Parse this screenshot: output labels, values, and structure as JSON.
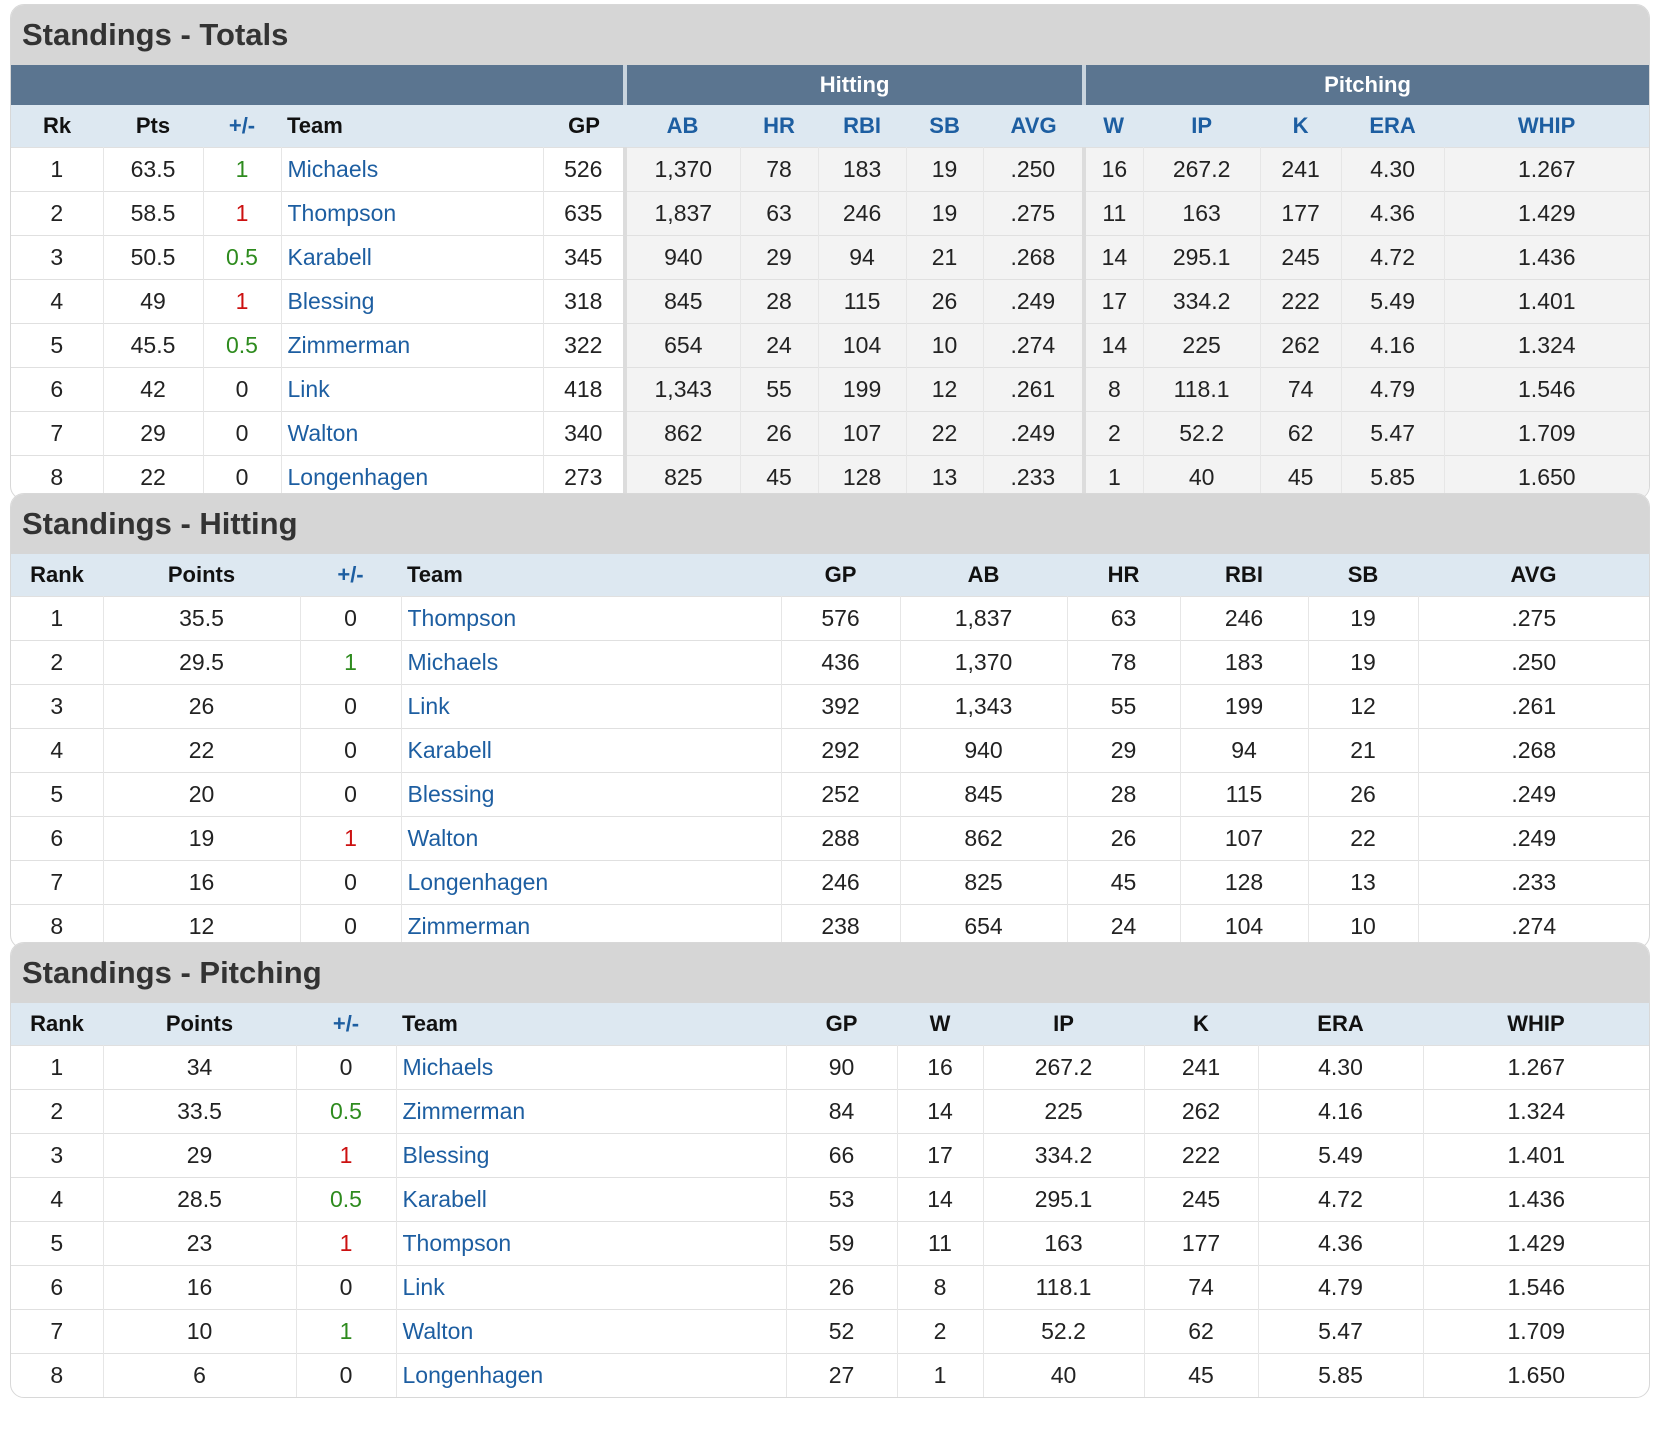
{
  "colors": {
    "positive": "#2e8b1e",
    "negative": "#cc1111",
    "link": "#1d5ea1",
    "group_header": "#5b7590"
  },
  "totals": {
    "title": "Standings - Totals",
    "groups": {
      "hitting": "Hitting",
      "pitching": "Pitching"
    },
    "columns": [
      "Rk",
      "Pts",
      "+/-",
      "Team",
      "GP",
      "AB",
      "HR",
      "RBI",
      "SB",
      "AVG",
      "W",
      "IP",
      "K",
      "ERA",
      "WHIP"
    ],
    "rows": [
      [
        "1",
        "63.5",
        "1",
        "Michaels",
        "526",
        "1,370",
        "78",
        "183",
        "19",
        ".250",
        "16",
        "267.2",
        "241",
        "4.30",
        "1.267"
      ],
      [
        "2",
        "58.5",
        "1",
        "Thompson",
        "635",
        "1,837",
        "63",
        "246",
        "19",
        ".275",
        "11",
        "163",
        "177",
        "4.36",
        "1.429"
      ],
      [
        "3",
        "50.5",
        "0.5",
        "Karabell",
        "345",
        "940",
        "29",
        "94",
        "21",
        ".268",
        "14",
        "295.1",
        "245",
        "4.72",
        "1.436"
      ],
      [
        "4",
        "49",
        "1",
        "Blessing",
        "318",
        "845",
        "28",
        "115",
        "26",
        ".249",
        "17",
        "334.2",
        "222",
        "5.49",
        "1.401"
      ],
      [
        "5",
        "45.5",
        "0.5",
        "Zimmerman",
        "322",
        "654",
        "24",
        "104",
        "10",
        ".274",
        "14",
        "225",
        "262",
        "4.16",
        "1.324"
      ],
      [
        "6",
        "42",
        "0",
        "Link",
        "418",
        "1,343",
        "55",
        "199",
        "12",
        ".261",
        "8",
        "118.1",
        "74",
        "4.79",
        "1.546"
      ],
      [
        "7",
        "29",
        "0",
        "Walton",
        "340",
        "862",
        "26",
        "107",
        "22",
        ".249",
        "2",
        "52.2",
        "62",
        "5.47",
        "1.709"
      ],
      [
        "8",
        "22",
        "0",
        "Longenhagen",
        "273",
        "825",
        "45",
        "128",
        "13",
        ".233",
        "1",
        "40",
        "45",
        "5.85",
        "1.650"
      ]
    ],
    "change_dir": [
      "up",
      "down",
      "up",
      "down",
      "up",
      "none",
      "none",
      "none"
    ]
  },
  "hitting": {
    "title": "Standings - Hitting",
    "columns": [
      "Rank",
      "Points",
      "+/-",
      "Team",
      "GP",
      "AB",
      "HR",
      "RBI",
      "SB",
      "AVG"
    ],
    "rows": [
      [
        "1",
        "35.5",
        "0",
        "Thompson",
        "576",
        "1,837",
        "63",
        "246",
        "19",
        ".275"
      ],
      [
        "2",
        "29.5",
        "1",
        "Michaels",
        "436",
        "1,370",
        "78",
        "183",
        "19",
        ".250"
      ],
      [
        "3",
        "26",
        "0",
        "Link",
        "392",
        "1,343",
        "55",
        "199",
        "12",
        ".261"
      ],
      [
        "4",
        "22",
        "0",
        "Karabell",
        "292",
        "940",
        "29",
        "94",
        "21",
        ".268"
      ],
      [
        "5",
        "20",
        "0",
        "Blessing",
        "252",
        "845",
        "28",
        "115",
        "26",
        ".249"
      ],
      [
        "6",
        "19",
        "1",
        "Walton",
        "288",
        "862",
        "26",
        "107",
        "22",
        ".249"
      ],
      [
        "7",
        "16",
        "0",
        "Longenhagen",
        "246",
        "825",
        "45",
        "128",
        "13",
        ".233"
      ],
      [
        "8",
        "12",
        "0",
        "Zimmerman",
        "238",
        "654",
        "24",
        "104",
        "10",
        ".274"
      ]
    ],
    "change_dir": [
      "none",
      "up",
      "none",
      "none",
      "none",
      "down",
      "none",
      "none"
    ]
  },
  "pitching": {
    "title": "Standings - Pitching",
    "columns": [
      "Rank",
      "Points",
      "+/-",
      "Team",
      "GP",
      "W",
      "IP",
      "K",
      "ERA",
      "WHIP"
    ],
    "rows": [
      [
        "1",
        "34",
        "0",
        "Michaels",
        "90",
        "16",
        "267.2",
        "241",
        "4.30",
        "1.267"
      ],
      [
        "2",
        "33.5",
        "0.5",
        "Zimmerman",
        "84",
        "14",
        "225",
        "262",
        "4.16",
        "1.324"
      ],
      [
        "3",
        "29",
        "1",
        "Blessing",
        "66",
        "17",
        "334.2",
        "222",
        "5.49",
        "1.401"
      ],
      [
        "4",
        "28.5",
        "0.5",
        "Karabell",
        "53",
        "14",
        "295.1",
        "245",
        "4.72",
        "1.436"
      ],
      [
        "5",
        "23",
        "1",
        "Thompson",
        "59",
        "11",
        "163",
        "177",
        "4.36",
        "1.429"
      ],
      [
        "6",
        "16",
        "0",
        "Link",
        "26",
        "8",
        "118.1",
        "74",
        "4.79",
        "1.546"
      ],
      [
        "7",
        "10",
        "1",
        "Walton",
        "52",
        "2",
        "52.2",
        "62",
        "5.47",
        "1.709"
      ],
      [
        "8",
        "6",
        "0",
        "Longenhagen",
        "27",
        "1",
        "40",
        "45",
        "5.85",
        "1.650"
      ]
    ],
    "change_dir": [
      "none",
      "up",
      "down",
      "up",
      "down",
      "none",
      "up",
      "none"
    ]
  }
}
